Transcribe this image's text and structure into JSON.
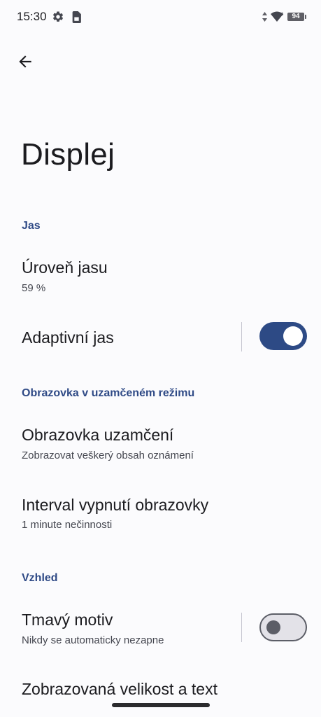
{
  "status_bar": {
    "time": "15:30",
    "battery": "94"
  },
  "page": {
    "title": "Displej"
  },
  "sections": [
    {
      "header": "Jas"
    },
    {
      "header": "Obrazovka v uzamčeném režimu"
    },
    {
      "header": "Vzhled"
    }
  ],
  "items": {
    "brightness": {
      "title": "Úroveň jasu",
      "subtitle": "59 %"
    },
    "adaptive": {
      "title": "Adaptivní jas",
      "enabled": true
    },
    "lock_screen": {
      "title": "Obrazovka uzamčení",
      "subtitle": "Zobrazovat veškerý obsah oznámení"
    },
    "timeout": {
      "title": "Interval vypnutí obrazovky",
      "subtitle": "1 minute nečinnosti"
    },
    "dark_theme": {
      "title": "Tmavý motiv",
      "subtitle": "Nikdy se automaticky nezapne",
      "enabled": false
    },
    "display_size": {
      "title": "Zobrazovaná velikost a text"
    }
  },
  "colors": {
    "accent": "#2d4a85",
    "section_header": "#2f4a86",
    "background": "#fbfbfd"
  },
  "icons": {
    "back": "arrow-back-icon",
    "settings": "gear-icon",
    "sim": "sim-card-icon",
    "wifi": "wifi-icon",
    "data": "data-arrows-icon",
    "battery": "battery-icon"
  }
}
